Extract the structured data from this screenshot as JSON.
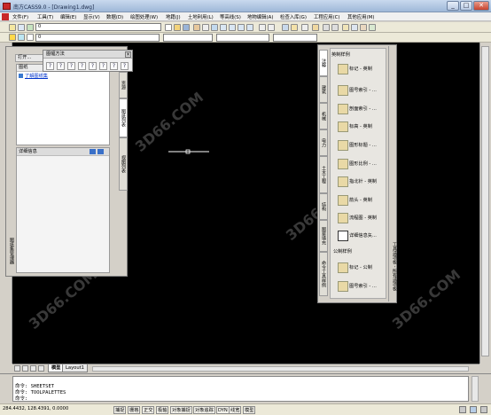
{
  "window": {
    "title": "南方CASS9.0 - [Drawing1.dwg]",
    "minimize": "_",
    "maximize": "□",
    "close": "✕"
  },
  "menubar": {
    "items": [
      "文件(F)",
      "工具(T)",
      "编辑(E)",
      "显示(V)",
      "数据(D)",
      "绘图处理(W)",
      "地籍(J)",
      "土地利用(L)",
      "等高线(S)",
      "地物编辑(A)",
      "检查入库(G)",
      "工程应用(C)",
      "其他应用(M)"
    ]
  },
  "toolbar": {
    "layer_value": "0",
    "style_value": "0"
  },
  "sheet_panel": {
    "open_label": "打开...",
    "list_header": "图纸",
    "list_link": "了解图纸集",
    "detail_label": "详细信息",
    "tabs": [
      "资源",
      "图纸列表",
      "视图列表"
    ],
    "vertical_title": "图纸集管理器"
  },
  "legend_toolbar": {
    "title": "图幅方法",
    "buttons": [
      "?",
      "?",
      "?",
      "?",
      "?",
      "?",
      "?",
      "?"
    ]
  },
  "palette": {
    "section1": "英制样例",
    "items": [
      "标记 - 英制",
      "图号索引 - ...",
      "剖面索引 - ...",
      "标高 - 英制",
      "图形标题 - ...",
      "图形比例 - ...",
      "指北针 - 英制",
      "箭头 - 英制",
      "流程图 - 英制",
      "详细信息矢..."
    ],
    "section2": "公制样例",
    "items2": [
      "标记 - 公制",
      "图号索引 - ..."
    ],
    "tabs": [
      "注释",
      "建筑",
      "机械",
      "电力",
      "土木工程",
      "结构",
      "图案填充",
      "命令工具样例"
    ],
    "vertical_title": "工具选项板 - 所有选项板"
  },
  "layout_tabs": [
    "模型",
    "Layout1"
  ],
  "command_line": {
    "lines": [
      "命令: SHEETSET",
      "命令: TOOLPALETTES",
      "命令:"
    ]
  },
  "statusbar": {
    "coords": "284.4432,  128.4391,  0.0000",
    "buttons": [
      "捕捉",
      "栅格",
      "正交",
      "极轴",
      "对象捕捉",
      "对象追踪",
      "DYN",
      "线宽",
      "模型"
    ]
  }
}
